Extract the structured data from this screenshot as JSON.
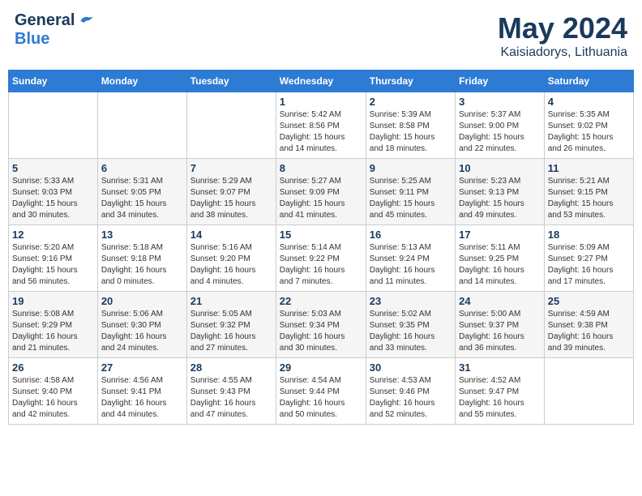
{
  "header": {
    "logo_general": "General",
    "logo_blue": "Blue",
    "month_title": "May 2024",
    "location": "Kaisiadorys, Lithuania"
  },
  "days_of_week": [
    "Sunday",
    "Monday",
    "Tuesday",
    "Wednesday",
    "Thursday",
    "Friday",
    "Saturday"
  ],
  "weeks": [
    [
      {
        "num": "",
        "info": ""
      },
      {
        "num": "",
        "info": ""
      },
      {
        "num": "",
        "info": ""
      },
      {
        "num": "1",
        "info": "Sunrise: 5:42 AM\nSunset: 8:56 PM\nDaylight: 15 hours\nand 14 minutes."
      },
      {
        "num": "2",
        "info": "Sunrise: 5:39 AM\nSunset: 8:58 PM\nDaylight: 15 hours\nand 18 minutes."
      },
      {
        "num": "3",
        "info": "Sunrise: 5:37 AM\nSunset: 9:00 PM\nDaylight: 15 hours\nand 22 minutes."
      },
      {
        "num": "4",
        "info": "Sunrise: 5:35 AM\nSunset: 9:02 PM\nDaylight: 15 hours\nand 26 minutes."
      }
    ],
    [
      {
        "num": "5",
        "info": "Sunrise: 5:33 AM\nSunset: 9:03 PM\nDaylight: 15 hours\nand 30 minutes."
      },
      {
        "num": "6",
        "info": "Sunrise: 5:31 AM\nSunset: 9:05 PM\nDaylight: 15 hours\nand 34 minutes."
      },
      {
        "num": "7",
        "info": "Sunrise: 5:29 AM\nSunset: 9:07 PM\nDaylight: 15 hours\nand 38 minutes."
      },
      {
        "num": "8",
        "info": "Sunrise: 5:27 AM\nSunset: 9:09 PM\nDaylight: 15 hours\nand 41 minutes."
      },
      {
        "num": "9",
        "info": "Sunrise: 5:25 AM\nSunset: 9:11 PM\nDaylight: 15 hours\nand 45 minutes."
      },
      {
        "num": "10",
        "info": "Sunrise: 5:23 AM\nSunset: 9:13 PM\nDaylight: 15 hours\nand 49 minutes."
      },
      {
        "num": "11",
        "info": "Sunrise: 5:21 AM\nSunset: 9:15 PM\nDaylight: 15 hours\nand 53 minutes."
      }
    ],
    [
      {
        "num": "12",
        "info": "Sunrise: 5:20 AM\nSunset: 9:16 PM\nDaylight: 15 hours\nand 56 minutes."
      },
      {
        "num": "13",
        "info": "Sunrise: 5:18 AM\nSunset: 9:18 PM\nDaylight: 16 hours\nand 0 minutes."
      },
      {
        "num": "14",
        "info": "Sunrise: 5:16 AM\nSunset: 9:20 PM\nDaylight: 16 hours\nand 4 minutes."
      },
      {
        "num": "15",
        "info": "Sunrise: 5:14 AM\nSunset: 9:22 PM\nDaylight: 16 hours\nand 7 minutes."
      },
      {
        "num": "16",
        "info": "Sunrise: 5:13 AM\nSunset: 9:24 PM\nDaylight: 16 hours\nand 11 minutes."
      },
      {
        "num": "17",
        "info": "Sunrise: 5:11 AM\nSunset: 9:25 PM\nDaylight: 16 hours\nand 14 minutes."
      },
      {
        "num": "18",
        "info": "Sunrise: 5:09 AM\nSunset: 9:27 PM\nDaylight: 16 hours\nand 17 minutes."
      }
    ],
    [
      {
        "num": "19",
        "info": "Sunrise: 5:08 AM\nSunset: 9:29 PM\nDaylight: 16 hours\nand 21 minutes."
      },
      {
        "num": "20",
        "info": "Sunrise: 5:06 AM\nSunset: 9:30 PM\nDaylight: 16 hours\nand 24 minutes."
      },
      {
        "num": "21",
        "info": "Sunrise: 5:05 AM\nSunset: 9:32 PM\nDaylight: 16 hours\nand 27 minutes."
      },
      {
        "num": "22",
        "info": "Sunrise: 5:03 AM\nSunset: 9:34 PM\nDaylight: 16 hours\nand 30 minutes."
      },
      {
        "num": "23",
        "info": "Sunrise: 5:02 AM\nSunset: 9:35 PM\nDaylight: 16 hours\nand 33 minutes."
      },
      {
        "num": "24",
        "info": "Sunrise: 5:00 AM\nSunset: 9:37 PM\nDaylight: 16 hours\nand 36 minutes."
      },
      {
        "num": "25",
        "info": "Sunrise: 4:59 AM\nSunset: 9:38 PM\nDaylight: 16 hours\nand 39 minutes."
      }
    ],
    [
      {
        "num": "26",
        "info": "Sunrise: 4:58 AM\nSunset: 9:40 PM\nDaylight: 16 hours\nand 42 minutes."
      },
      {
        "num": "27",
        "info": "Sunrise: 4:56 AM\nSunset: 9:41 PM\nDaylight: 16 hours\nand 44 minutes."
      },
      {
        "num": "28",
        "info": "Sunrise: 4:55 AM\nSunset: 9:43 PM\nDaylight: 16 hours\nand 47 minutes."
      },
      {
        "num": "29",
        "info": "Sunrise: 4:54 AM\nSunset: 9:44 PM\nDaylight: 16 hours\nand 50 minutes."
      },
      {
        "num": "30",
        "info": "Sunrise: 4:53 AM\nSunset: 9:46 PM\nDaylight: 16 hours\nand 52 minutes."
      },
      {
        "num": "31",
        "info": "Sunrise: 4:52 AM\nSunset: 9:47 PM\nDaylight: 16 hours\nand 55 minutes."
      },
      {
        "num": "",
        "info": ""
      }
    ]
  ]
}
